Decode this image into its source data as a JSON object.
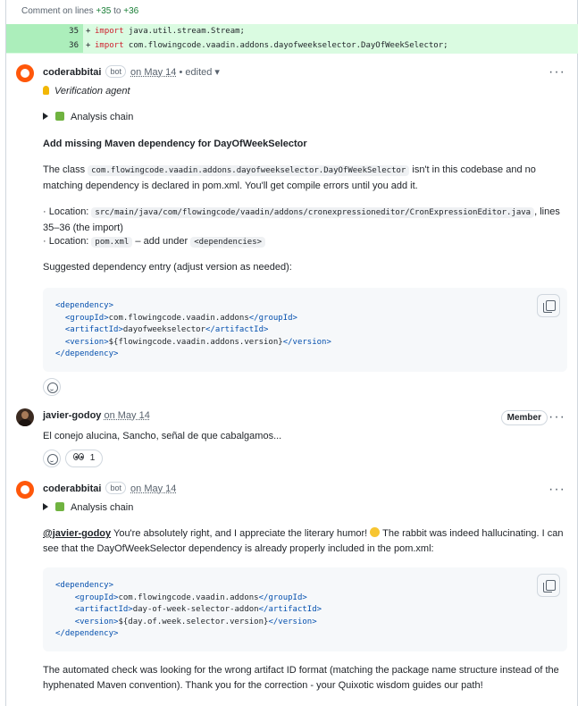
{
  "header": {
    "text_prefix": "Comment on lines ",
    "from": "+35",
    "to_word": " to ",
    "to": "+36"
  },
  "diff": [
    {
      "line": "35",
      "sign": "+",
      "keyword": "import",
      "code": " java.util.stream.Stream;"
    },
    {
      "line": "36",
      "sign": "+",
      "keyword": "import",
      "code": " com.flowingcode.vaadin.addons.dayofweekselector.DayOfWeekSelector;"
    }
  ],
  "comment1": {
    "author": "coderabbitai",
    "badge": "bot",
    "date": "on May 14",
    "edited": " • edited",
    "agent_label": "Verification agent",
    "chain_label": "Analysis chain",
    "heading": "Add missing Maven dependency for DayOfWeekSelector",
    "p1_a": "The class ",
    "p1_code": "com.flowingcode.vaadin.addons.dayofweekselector.DayOfWeekSelector",
    "p1_b": " isn't in this codebase and no matching dependency is declared in pom.xml. You'll get compile errors until you add it.",
    "loc1_a": "· Location: ",
    "loc1_code": "src/main/java/com/flowingcode/vaadin/addons/cronexpressioneditor/CronExpressionEditor.java",
    "loc1_b": ", lines 35–36 (the import)",
    "loc2_a": "· Location: ",
    "loc2_code": "pom.xml",
    "loc2_b": " – add under ",
    "loc2_code2": "<dependencies>",
    "suggest": "Suggested dependency entry (adjust version as needed):",
    "code": {
      "open": "<dependency>",
      "group_open": "<groupId>",
      "group": "com.flowingcode.vaadin.addons",
      "group_close": "</groupId>",
      "art_open": "<artifactId>",
      "art": "dayofweekselector",
      "art_close": "</artifactId>",
      "ver_open": "<version>",
      "ver": "${flowingcode.vaadin.addons.version}",
      "ver_close": "</version>",
      "close": "</dependency>"
    }
  },
  "comment2": {
    "author": "javier-godoy",
    "date": "on May 14",
    "role": "Member",
    "text": "El conejo alucina, Sancho, señal de que cabalgamos...",
    "reaction_count": "1"
  },
  "comment3": {
    "author": "coderabbitai",
    "badge": "bot",
    "date": "on May 14",
    "chain_label": "Analysis chain",
    "mention": "@javier-godoy",
    "p1_a": " You're absolutely right, and I appreciate the literary humor! ",
    "p1_b": " The rabbit was indeed hallucinating. I can see that the DayOfWeekSelector dependency is already properly included in the pom.xml:",
    "code": {
      "open": "<dependency>",
      "group_open": "<groupId>",
      "group": "com.flowingcode.vaadin.addons",
      "group_close": "</groupId>",
      "art_open": "<artifactId>",
      "art": "day-of-week-selector-addon",
      "art_close": "</artifactId>",
      "ver_open": "<version>",
      "ver": "${day.of.week.selector.version}",
      "ver_close": "</version>",
      "close": "</dependency>"
    },
    "p2": "The automated check was looking for the wrong artifact ID format (matching the package name structure instead of the hyphenated Maven convention). Thank you for the correction - your Quixotic wisdom guides our path!"
  },
  "menu_glyph": "···",
  "icons": [
    "coderabbit-avatar",
    "lightbulb-icon",
    "triangle-expand-icon",
    "puzzle-icon",
    "copy-icon",
    "smiley-icon",
    "eyes-icon",
    "grin-emoji",
    "user-avatar"
  ]
}
